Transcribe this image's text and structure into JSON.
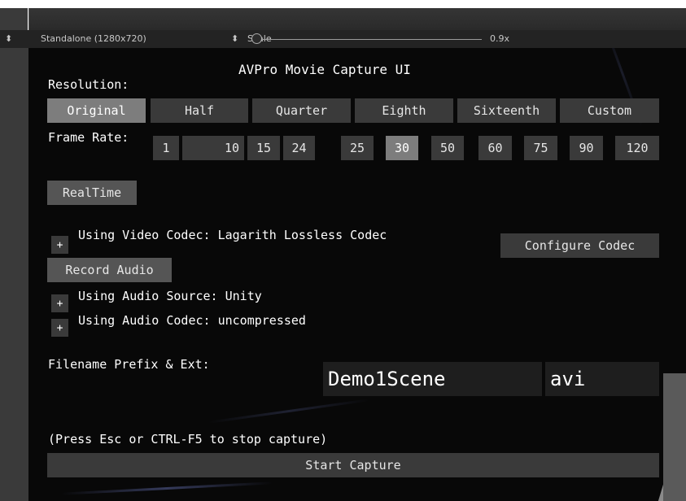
{
  "toolbar": {
    "display_label": "Standalone (1280x720)",
    "scale_label": "Scale",
    "scale_value": "0.9x",
    "scale_fraction": 0.0
  },
  "capture_ui": {
    "title": "AVPro Movie Capture UI",
    "resolution_label": "Resolution:",
    "resolutions": [
      "Original",
      "Half",
      "Quarter",
      "Eighth",
      "Sixteenth",
      "Custom"
    ],
    "resolution_selected": "Original",
    "frame_rate_label": "Frame Rate:",
    "frame_rates": [
      "1",
      "10",
      "15",
      "24",
      "25",
      "30",
      "50",
      "60",
      "75",
      "90",
      "120"
    ],
    "frame_rate_selected": "30",
    "realtime_label": "RealTime",
    "expand_symbol": "+",
    "video_codec_text": "Using Video Codec: Lagarith Lossless Codec",
    "configure_codec_label": "Configure Codec",
    "record_audio_label": "Record Audio",
    "audio_source_text": "Using Audio Source: Unity",
    "audio_codec_text": "Using Audio Codec: uncompressed",
    "filename_label": "Filename Prefix & Ext:",
    "filename_prefix": "Demo1Scene",
    "filename_ext": "avi",
    "stop_hint": "(Press Esc or CTRL-F5 to stop capture)",
    "start_capture_label": "Start Capture"
  },
  "colors": {
    "background": "#080808",
    "button": "#3a3a3a",
    "button_selected": "#7d7d7d",
    "text": "#ffffff"
  }
}
